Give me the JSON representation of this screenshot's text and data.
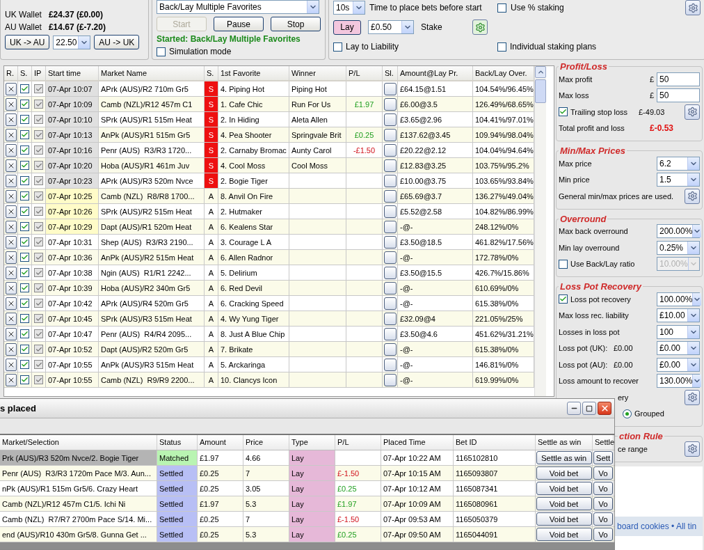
{
  "wallets": {
    "rows": [
      {
        "label": "UK Wallet",
        "value": "£24.37 (£0.00)"
      },
      {
        "label": "AU Wallet",
        "value": "£14.67 (£-7.20)"
      }
    ],
    "transfer": {
      "left_button": "UK -> AU",
      "amount": "22.50",
      "right_button": "AU -> UK"
    }
  },
  "strategy": {
    "selected": "Back/Lay Multiple Favorites",
    "buttons": [
      {
        "label": "Start",
        "disabled": true
      },
      {
        "label": "Pause",
        "disabled": false
      },
      {
        "label": "Stop",
        "disabled": false
      }
    ],
    "status": "Started: Back/Lay Multiple Favorites",
    "simulation": {
      "label": "Simulation mode",
      "checked": false
    }
  },
  "staking": {
    "time_value": "10s",
    "time_label": "Time to place bets before start",
    "percent": {
      "label": "Use % staking",
      "checked": false
    },
    "bet_type": {
      "label": "Lay",
      "on": true
    },
    "stake_value": "£0.50",
    "stake_label": "Stake",
    "lay_to_liability": {
      "label": "Lay to Liability",
      "checked": false
    },
    "individual_plans": {
      "label": "Individual staking plans",
      "checked": false
    }
  },
  "markets": {
    "columns": [
      "R.",
      "S.",
      "IP",
      "Start time",
      "Market Name",
      "S.",
      "1st Favorite",
      "Winner",
      "P/L",
      "Sl.",
      "Amount@Lay Pr.",
      "Back/Lay Over."
    ],
    "rows": [
      {
        "enabled": true,
        "in_play": true,
        "start": "07-Apr 10:07",
        "soon": false,
        "market": "APrk (AUS)/R2 710m Gr5",
        "state": "S",
        "started": true,
        "favorite": "4. Piping Hot",
        "winner": "Piping Hot",
        "amount": "£64.15@1.51",
        "overround": "104.54%/96.45%"
      },
      {
        "enabled": true,
        "in_play": true,
        "start": "07-Apr 10:09",
        "soon": false,
        "market": "Camb (NZL)/R12 457m C1",
        "state": "S",
        "started": true,
        "favorite": "1. Cafe Chic",
        "winner": "Run For Us",
        "pl": "£1.97",
        "loss": false,
        "amount": "£6.00@3.5",
        "overround": "126.49%/68.65%"
      },
      {
        "enabled": true,
        "in_play": true,
        "start": "07-Apr 10:10",
        "soon": false,
        "market": "SPrk (AUS)/R1 515m Heat",
        "state": "S",
        "started": true,
        "favorite": "2. In Hiding",
        "winner": "Aleta Allen",
        "amount": "£3.65@2.96",
        "overround": "104.41%/97.01%"
      },
      {
        "enabled": true,
        "in_play": true,
        "start": "07-Apr 10:13",
        "soon": false,
        "market": "AnPk (AUS)/R1 515m Gr5",
        "state": "S",
        "started": true,
        "favorite": "4. Pea Shooter",
        "winner": "Springvale Brit",
        "pl": "£0.25",
        "loss": false,
        "amount": "£137.62@3.45",
        "overround": "109.94%/98.04%"
      },
      {
        "enabled": true,
        "in_play": true,
        "start": "07-Apr 10:16",
        "soon": false,
        "market": "Penr (AUS)  R3/R3 1720...",
        "state": "S",
        "started": true,
        "favorite": "2. Carnaby Bromac",
        "winner": "Aunty Carol",
        "pl": "-£1.50",
        "loss": true,
        "amount": "£20.22@2.12",
        "overround": "104.04%/94.64%"
      },
      {
        "enabled": true,
        "in_play": true,
        "start": "07-Apr 10:20",
        "soon": false,
        "market": "Hoba (AUS)/R1 461m Juv",
        "state": "S",
        "started": true,
        "favorite": "4. Cool Moss",
        "winner": "Cool Moss",
        "amount": "£12.83@3.25",
        "overround": "103.75%/95.2%"
      },
      {
        "enabled": true,
        "in_play": true,
        "start": "07-Apr 10:23",
        "soon": false,
        "market": "APrk (AUS)/R3 520m Nvce",
        "state": "S",
        "started": true,
        "favorite": "2. Bogie Tiger",
        "amount": "£10.00@3.75",
        "overround": "103.65%/93.84%"
      },
      {
        "enabled": true,
        "in_play": true,
        "start": "07-Apr 10:25",
        "soon": true,
        "market": "Camb (NZL)  R8/R8 1700...",
        "state": "A",
        "started": false,
        "favorite": "8. Anvil On Fire",
        "amount": "£65.69@3.7",
        "overround": "136.27%/49.04%"
      },
      {
        "enabled": true,
        "in_play": true,
        "start": "07-Apr 10:26",
        "soon": true,
        "market": "SPrk (AUS)/R2 515m Heat",
        "state": "A",
        "started": false,
        "favorite": "2. Hutmaker",
        "amount": "£5.52@2.58",
        "overround": "104.82%/86.99%"
      },
      {
        "enabled": true,
        "in_play": true,
        "start": "07-Apr 10:29",
        "soon": true,
        "market": "Dapt (AUS)/R1 520m Heat",
        "state": "A",
        "started": false,
        "favorite": "6. Kealens Star",
        "amount": "-@-",
        "overround": "248.12%/0%"
      },
      {
        "enabled": true,
        "in_play": true,
        "start": "07-Apr 10:31",
        "soon": false,
        "market": "Shep (AUS)  R3/R3 2190...",
        "state": "A",
        "started": false,
        "favorite": "3. Courage L A",
        "amount": "£3.50@18.5",
        "overround": "461.82%/17.56%"
      },
      {
        "enabled": true,
        "in_play": true,
        "start": "07-Apr 10:36",
        "soon": false,
        "market": "AnPk (AUS)/R2 515m Heat",
        "state": "A",
        "started": false,
        "favorite": "6. Allen Radnor",
        "amount": "-@-",
        "overround": "172.78%/0%"
      },
      {
        "enabled": true,
        "in_play": true,
        "start": "07-Apr 10:38",
        "soon": false,
        "market": "Ngin (AUS)  R1/R1 2242...",
        "state": "A",
        "started": false,
        "favorite": "5. Delirium",
        "amount": "£3.50@15.5",
        "overround": "426.7%/15.86%"
      },
      {
        "enabled": true,
        "in_play": true,
        "start": "07-Apr 10:39",
        "soon": false,
        "market": "Hoba (AUS)/R2 340m Gr5",
        "state": "A",
        "started": false,
        "favorite": "6. Red Devil",
        "amount": "-@-",
        "overround": "610.69%/0%"
      },
      {
        "enabled": true,
        "in_play": true,
        "start": "07-Apr 10:42",
        "soon": false,
        "market": "APrk (AUS)/R4 520m Gr5",
        "state": "A",
        "started": false,
        "favorite": "6. Cracking Speed",
        "amount": "-@-",
        "overround": "615.38%/0%"
      },
      {
        "enabled": true,
        "in_play": true,
        "start": "07-Apr 10:45",
        "soon": false,
        "market": "SPrk (AUS)/R3 515m Heat",
        "state": "A",
        "started": false,
        "favorite": "4. Wy Yung Tiger",
        "amount": "£32.09@4",
        "overround": "221.05%/25%"
      },
      {
        "enabled": true,
        "in_play": true,
        "start": "07-Apr 10:47",
        "soon": false,
        "market": "Penr (AUS)  R4/R4 2095...",
        "state": "A",
        "started": false,
        "favorite": "8. Just A Blue Chip",
        "amount": "£3.50@4.6",
        "overround": "451.62%/31.21%"
      },
      {
        "enabled": true,
        "in_play": true,
        "start": "07-Apr 10:52",
        "soon": false,
        "market": "Dapt (AUS)/R2 520m Gr5",
        "state": "A",
        "started": false,
        "favorite": "7. Brikate",
        "amount": "-@-",
        "overround": "615.38%/0%"
      },
      {
        "enabled": true,
        "in_play": true,
        "start": "07-Apr 10:55",
        "soon": false,
        "market": "AnPk (AUS)/R3 515m Heat",
        "state": "A",
        "started": false,
        "favorite": "5. Arckaringa",
        "amount": "-@-",
        "overround": "146.81%/0%"
      },
      {
        "enabled": true,
        "in_play": true,
        "start": "07-Apr 10:55",
        "soon": false,
        "market": "Camb (NZL)  R9/R9 2200...",
        "state": "A",
        "started": false,
        "favorite": "10. Clancys Icon",
        "amount": "-@-",
        "overround": "619.99%/0%"
      }
    ]
  },
  "panel": {
    "sections": [
      {
        "title": "Profit/Loss",
        "rows": [
          {
            "kind": "field",
            "label": "Max profit",
            "currency": "£",
            "value": "50"
          },
          {
            "kind": "field",
            "label": "Max loss",
            "currency": "£",
            "value": "50"
          },
          {
            "kind": "check",
            "label": "Trailing stop loss",
            "checked": true,
            "reading": "£-49.03",
            "gear": true
          },
          {
            "kind": "total",
            "label": "Total profit and loss",
            "value": "£-0.53"
          }
        ]
      },
      {
        "title": "Min/Max Prices",
        "rows": [
          {
            "kind": "select",
            "label": "Max price",
            "value": "6.2"
          },
          {
            "kind": "select",
            "label": "Min price",
            "value": "1.5"
          },
          {
            "kind": "note",
            "label": "General min/max prices are used.",
            "gear": true
          }
        ]
      },
      {
        "title": "Overround",
        "rows": [
          {
            "kind": "select",
            "label": "Max back overround",
            "value": "200.00%"
          },
          {
            "kind": "select",
            "label": "Min lay overround",
            "value": "0.25%"
          },
          {
            "kind": "check",
            "label": "Use Back/Lay ratio",
            "checked": false,
            "value": "10.00%",
            "disabled": true
          }
        ]
      },
      {
        "title": "Loss Pot Recovery",
        "rows": [
          {
            "kind": "check",
            "label": "Loss pot recovery",
            "checked": true,
            "value": "100.00%",
            "disabled": false
          },
          {
            "kind": "select",
            "label": "Max loss rec. liability",
            "value": "£10.00"
          },
          {
            "kind": "select",
            "label": "Losses in loss pot",
            "value": "100"
          },
          {
            "kind": "select",
            "label": "Loss pot (UK):",
            "reading": "£0.00",
            "value": "£0.00"
          },
          {
            "kind": "select",
            "label": "Loss pot (AU):",
            "reading": "£0.00",
            "value": "£0.00"
          },
          {
            "kind": "select",
            "label": "Loss amount to recover",
            "value": "130.00%"
          },
          {
            "kind": "note",
            "label": "ery",
            "gear": true
          },
          {
            "kind": "radio",
            "label": "Grouped",
            "selected": true
          }
        ]
      },
      {
        "title": "ction Rule",
        "rows": [
          {
            "kind": "note",
            "label": "ce range",
            "gear": true
          }
        ]
      }
    ],
    "footer": "board cookies • All tin"
  },
  "bets_window": {
    "title": "s placed",
    "columns": [
      "Market/Selection",
      "Status",
      "Amount",
      "Price",
      "Type",
      "P/L",
      "Placed Time",
      "Bet ID",
      "Settle as win",
      "Settle"
    ],
    "rows": [
      {
        "selected": true,
        "market": "Prk (AUS)/R3 520m Nvce/2. Bogie Tiger",
        "status": "Matched",
        "matched": true,
        "amount": "£1.97",
        "price": "4.66",
        "type": "Lay",
        "placed": "07-Apr 10:22 AM",
        "bet_id": "1165102810",
        "action": "Settle as win",
        "action_2": "Sett"
      },
      {
        "selected": false,
        "market": "Penr (AUS)  R3/R3 1720m Pace M/3. Aun...",
        "status": "Settled",
        "matched": false,
        "amount": "£0.25",
        "price": "7",
        "type": "Lay",
        "pl": "£-1.50",
        "loss": true,
        "placed": "07-Apr 10:15 AM",
        "bet_id": "1165093807",
        "action": "Void bet",
        "action_2": "Vo"
      },
      {
        "selected": false,
        "market": "nPk (AUS)/R1 515m Gr5/6. Crazy Heart",
        "status": "Settled",
        "matched": false,
        "amount": "£0.25",
        "price": "3.05",
        "type": "Lay",
        "pl": "£0.25",
        "loss": false,
        "placed": "07-Apr 10:12 AM",
        "bet_id": "1165087341",
        "action": "Void bet",
        "action_2": "Vo"
      },
      {
        "selected": false,
        "market": "Camb (NZL)/R12 457m C1/5. Ichi Ni",
        "status": "Settled",
        "matched": false,
        "amount": "£1.97",
        "price": "5.3",
        "type": "Lay",
        "pl": "£1.97",
        "loss": false,
        "placed": "07-Apr 10:09 AM",
        "bet_id": "1165080961",
        "action": "Void bet",
        "action_2": "Vo"
      },
      {
        "selected": false,
        "market": "Camb (NZL)  R7/R7 2700m Pace S/14. Mi...",
        "status": "Settled",
        "matched": false,
        "amount": "£0.25",
        "price": "7",
        "type": "Lay",
        "pl": "£-1.50",
        "loss": true,
        "placed": "07-Apr 09:53 AM",
        "bet_id": "1165050379",
        "action": "Void bet",
        "action_2": "Vo"
      },
      {
        "selected": false,
        "market": "end (AUS)/R10 430m Gr5/8. Gunna Get ...",
        "status": "Settled",
        "matched": false,
        "amount": "£0.25",
        "price": "5.3",
        "type": "Lay",
        "pl": "£0.25",
        "loss": false,
        "placed": "07-Apr 09:50 AM",
        "bet_id": "1165044091",
        "action": "Void bet",
        "action_2": "Vo"
      }
    ]
  }
}
